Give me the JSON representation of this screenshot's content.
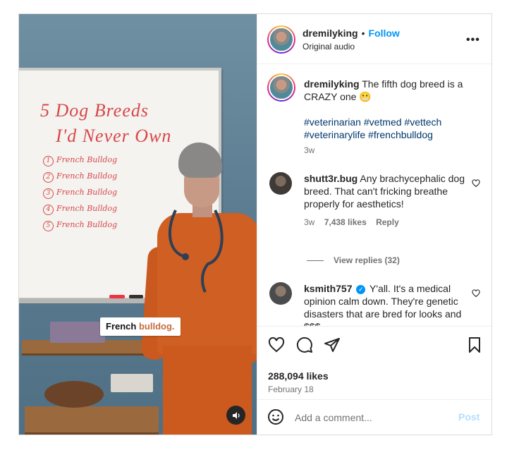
{
  "video": {
    "board_title_line1": "5 Dog Breeds",
    "board_title_line2": "I'd Never Own",
    "board_list": [
      {
        "num": "1",
        "text": "French Bulldog"
      },
      {
        "num": "2",
        "text": "French Bulldog"
      },
      {
        "num": "3",
        "text": "French Bulldog"
      },
      {
        "num": "4",
        "text": "French Bulldog"
      },
      {
        "num": "5",
        "text": "French Bulldog"
      }
    ],
    "caption_part1": "French",
    "caption_part2": "bulldog.",
    "audio_icon": "speaker-icon"
  },
  "header": {
    "username": "dremilyking",
    "separator": "•",
    "follow_label": "Follow",
    "subtitle": "Original audio",
    "more_icon": "•••"
  },
  "caption": {
    "username": "dremilyking",
    "text": "The fifth dog breed is a CRAZY one 😬",
    "hashtags": "#veterinarian #vetmed #vettech #veterinarylife #frenchbulldog",
    "time": "3w"
  },
  "comments": [
    {
      "username": "shutt3r.bug",
      "text": "Any brachycephalic dog breed. That can't fricking breathe properly for aesthetics!",
      "time": "3w",
      "likes": "7,438 likes",
      "reply_label": "Reply",
      "view_replies": "View replies (32)"
    },
    {
      "username": "ksmith757",
      "verified": true,
      "text": "Y'all. It's a medical opinion calm down. They're genetic disasters that are bred for looks and $$$"
    }
  ],
  "actions": {
    "likes": "288,094 likes",
    "date": "February 18"
  },
  "add_comment": {
    "placeholder": "Add a comment...",
    "post_label": "Post"
  },
  "colors": {
    "accent": "#0095f6",
    "hashtag": "#00376b",
    "post_disabled": "#b2dffc",
    "scrubs": "#cf5f22"
  }
}
